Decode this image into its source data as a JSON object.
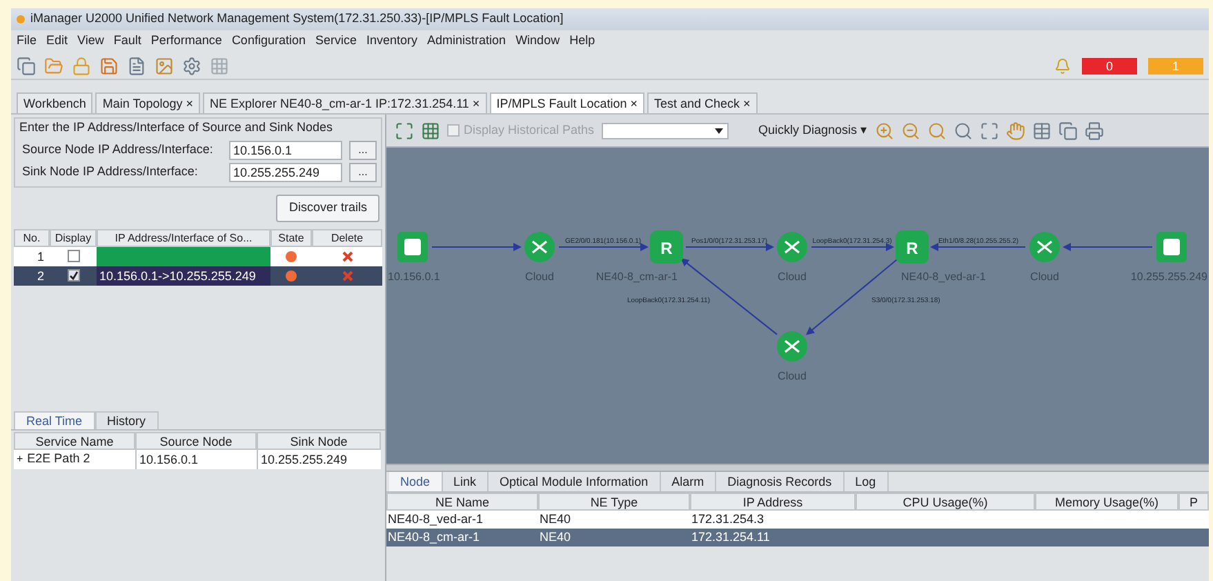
{
  "window": {
    "title": "iManager U2000 Unified Network Management System(172.31.250.33)-[IP/MPLS Fault Location]"
  },
  "menu": [
    "File",
    "Edit",
    "View",
    "Fault",
    "Performance",
    "Configuration",
    "Service",
    "Inventory",
    "Administration",
    "Window",
    "Help"
  ],
  "alarm_counters": [
    {
      "count": "0",
      "color": "#e8262b"
    },
    {
      "count": "1",
      "color": "#f5a623"
    }
  ],
  "tabs": [
    {
      "label": "Workbench",
      "selected": false
    },
    {
      "label": "Main Topology ×",
      "selected": false
    },
    {
      "label": "NE Explorer NE40-8_cm-ar-1 IP:172.31.254.11 ×",
      "selected": false
    },
    {
      "label": "IP/MPLS Fault Location ×",
      "selected": true
    },
    {
      "label": "Test and Check ×",
      "selected": false
    }
  ],
  "input_group": {
    "title": "Enter the IP Address/Interface of Source and Sink Nodes",
    "fields": [
      {
        "label": "Source Node IP Address/Interface:",
        "value": "10.156.0.1"
      },
      {
        "label": "Sink Node IP Address/Interface:",
        "value": "10.255.255.249"
      }
    ],
    "browse_label": "...",
    "discover_button": "Discover trails"
  },
  "trails": {
    "columns": [
      "No.",
      "Display",
      "IP Address/Interface of So...",
      "State",
      "Delete"
    ],
    "rows": [
      {
        "no": "1",
        "checked": false,
        "ip": "",
        "selected": false
      },
      {
        "no": "2",
        "checked": true,
        "ip": "10.156.0.1->10.255.255.249",
        "selected": true
      }
    ]
  },
  "service_tabs": [
    {
      "label": "Real Time",
      "selected": true
    },
    {
      "label": "History",
      "selected": false
    }
  ],
  "services": {
    "columns": [
      "Service Name",
      "Source Node",
      "Sink Node"
    ],
    "rows": [
      {
        "expand": "+",
        "name": "E2E Path 2",
        "source": "10.156.0.1",
        "sink": "10.255.255.249"
      }
    ]
  },
  "topology_toolbar": {
    "history_checkbox": {
      "label": "Display Historical Paths",
      "checked": false
    },
    "diagnosis_button": "Quickly Diagnosis",
    "caret": "▾"
  },
  "diagram": {
    "nodes": [
      {
        "kind": "host",
        "label": "10.156.0.1"
      },
      {
        "kind": "cloud",
        "label": "Cloud"
      },
      {
        "kind": "router",
        "label": "NE40-8_cm-ar-1",
        "badge": "R"
      },
      {
        "kind": "cloud",
        "label": "Cloud"
      },
      {
        "kind": "router",
        "label": "NE40-8_ved-ar-1",
        "badge": "R"
      },
      {
        "kind": "cloud",
        "label": "Cloud"
      },
      {
        "kind": "host",
        "label": "10.255.255.249"
      },
      {
        "kind": "cloud",
        "label": "Cloud"
      }
    ],
    "links": [
      {
        "kind": "arrow"
      },
      {
        "label": "GE2/0/0.181(10.156.0.1)"
      },
      {
        "label": "Pos1/0/0(172.31.253.17)"
      },
      {
        "label": "LoopBack0(172.31.254.3)"
      },
      {
        "label": "Eth1/0/8.28(10.255.255.2)"
      },
      {
        "kind": "arrow"
      },
      {
        "label": "LoopBack0(172.31.254.11)"
      },
      {
        "label": "S3/0/0(172.31.253.18)"
      }
    ]
  },
  "detail_tabs": [
    {
      "label": "Node",
      "selected": true
    },
    {
      "label": "Link",
      "selected": false
    },
    {
      "label": "Optical Module Information",
      "selected": false
    },
    {
      "label": "Alarm",
      "selected": false
    },
    {
      "label": "Diagnosis Records",
      "selected": false
    },
    {
      "label": "Log",
      "selected": false
    }
  ],
  "nodes_table": {
    "columns": [
      "NE Name",
      "NE Type",
      "IP Address",
      "CPU Usage(%)",
      "Memory Usage(%)",
      "P"
    ],
    "rows": [
      {
        "name": "NE40-8_ved-ar-1",
        "type": "NE40",
        "ip": "172.31.254.3",
        "selected": false
      },
      {
        "name": "NE40-8_cm-ar-1",
        "type": "NE40",
        "ip": "172.31.254.11",
        "selected": true
      }
    ]
  }
}
